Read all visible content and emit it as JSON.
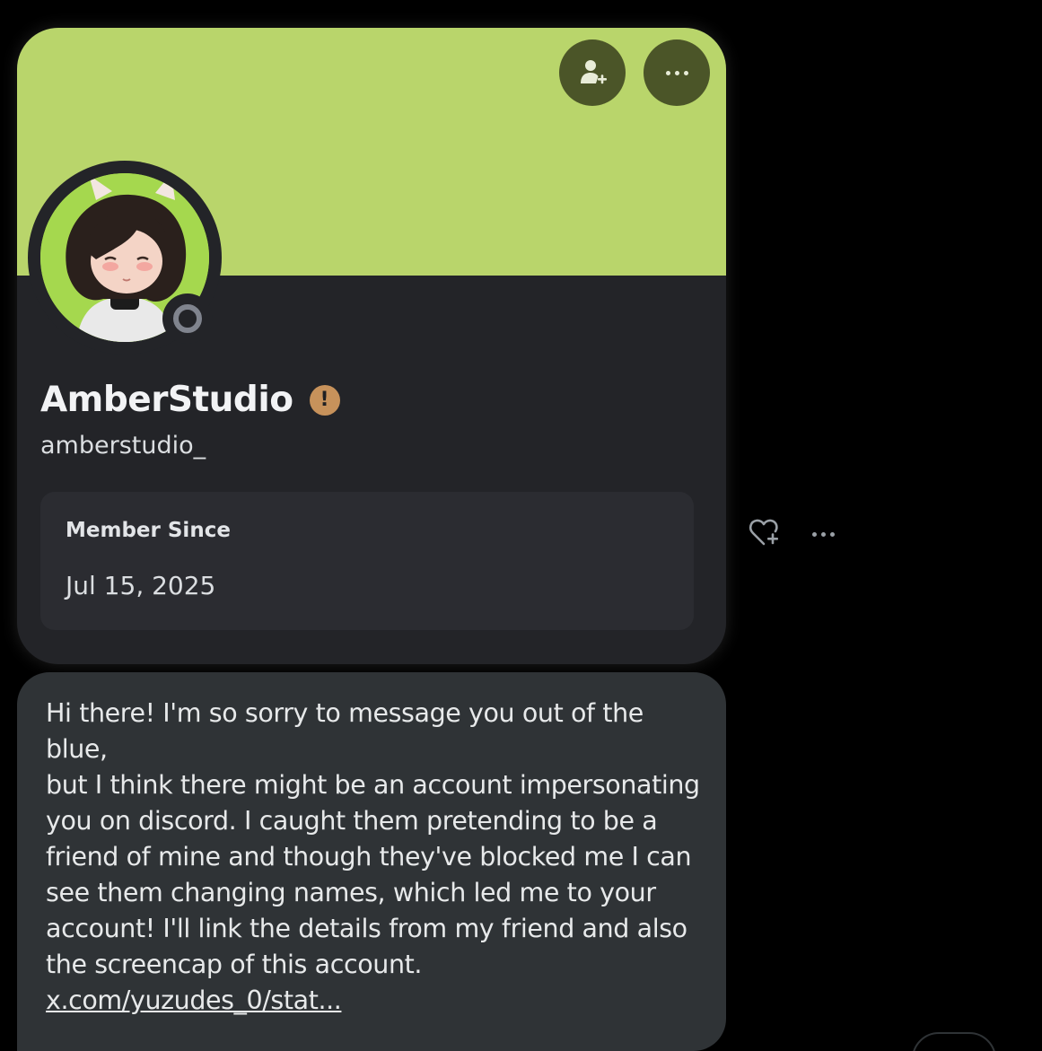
{
  "profile": {
    "display_name": "AmberStudio",
    "username": "amberstudio_",
    "warning_badge_glyph": "!",
    "banner_color": "#b9d56b",
    "status": "offline",
    "actions": [
      {
        "icon": "add-friend-icon"
      },
      {
        "icon": "more-dots-icon"
      }
    ],
    "member_since_label": "Member Since",
    "member_since_value": "Jul 15, 2025"
  },
  "side_actions": {
    "react_icon": "heart-add-icon",
    "more_icon": "more-dots-icon"
  },
  "message": {
    "text": "Hi there! I'm so sorry to message you out of the blue,\nbut I think there might be an account impersonating\nyou on discord. I caught them pretending to be a\nfriend of mine and though they've blocked me I can\nsee them changing names, which led me to your\naccount! I'll link the details from my friend and also\nthe screencap of this account.",
    "link_text": "x.com/yuzudes_0/stat..."
  }
}
